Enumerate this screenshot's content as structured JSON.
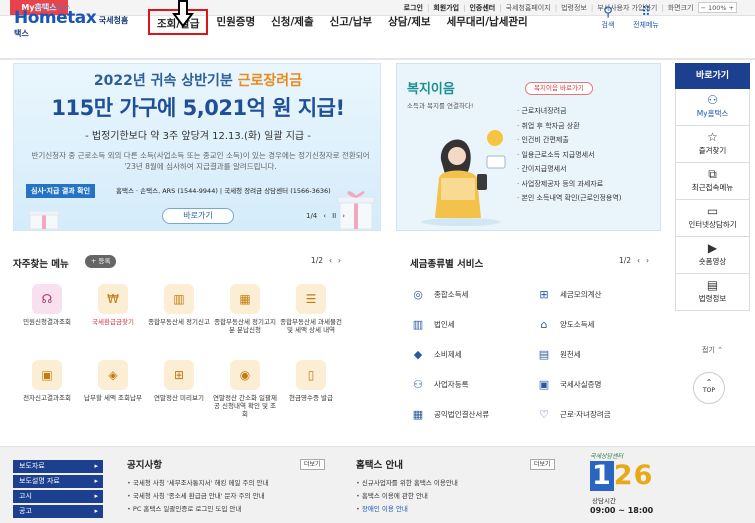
{
  "topbar": {
    "my_tab": "My홈택스",
    "login": "로그인",
    "signup": "회원가입",
    "cert_center": "인증센터",
    "links": [
      "국세청홈페이지",
      "법령정보",
      "부서사용자 가입하기",
      "화면크기"
    ],
    "zoom": "100%",
    "zoom_minus": "−",
    "zoom_plus": "+"
  },
  "header": {
    "logo_main": "Hometax",
    "logo_sub": "국세청홈택스",
    "logo_tag": "편리한 납세서비스",
    "nav": [
      "조회/발급",
      "민원증명",
      "신청/제출",
      "신고/납부",
      "상담/제보",
      "세무대리/납세관리"
    ],
    "search": "검색",
    "all_menu": "전체메뉴"
  },
  "banner": {
    "line1_prefix": "2022년 귀속 상반기분",
    "line1_highlight": "근로장려금",
    "line2": "115만 가구에 5,021억 원 지급!",
    "line3": "- 법정기한보다 약 3주 앞당겨 12.13.(화) 일괄 지급 -",
    "line4": "반기신청자 중 근로소득 외의 다른 소득(사업소득 또는 종교인 소득)이 있는 경우에는 정기신청자로 전환되어 '23년 8월에 심사하여 지급결과를 알려드립니다.",
    "chip": "심사·지급 결과 확인",
    "contact": "홈택스 · 손택스, ARS (1544-9944) | 국세청 장려금 상담센터 (1566-3636)",
    "goto": "바로가기",
    "pager": "1/4",
    "prev": "‹",
    "pause": "II",
    "next": "›"
  },
  "welfare": {
    "title": "복지이음",
    "subtitle": "소득과 복지를 연결하다!",
    "button": "복지이음 바로가기",
    "items": [
      "근로자녀장려금",
      "취업 후 학자금 상환",
      "인건비 간편제출",
      "일용근로소득 지급명세서",
      "간이지급명세서",
      "사업장제공자 등의 과세자료",
      "본인 소득내역 확인(근로인정용역)"
    ]
  },
  "quick": {
    "title": "바로가기",
    "items": [
      {
        "label": "My홈택스",
        "icon": "person-icon"
      },
      {
        "label": "즐겨찾기",
        "icon": "star-icon"
      },
      {
        "label": "최근접속메뉴",
        "icon": "recent-icon"
      },
      {
        "label": "인터넷상담하기",
        "icon": "chat-icon"
      },
      {
        "label": "숏폼영상",
        "icon": "play-icon"
      },
      {
        "label": "법령정보",
        "icon": "book-icon"
      }
    ],
    "fold": "접기 ⌃",
    "top": "TOP"
  },
  "fav": {
    "title": "자주찾는 메뉴",
    "register": "+ 등록",
    "pager": "1/2",
    "prev": "‹",
    "next": "›",
    "items": [
      "민원신청결과조회",
      "국세환급금찾기",
      "종합부동산세 정기신고",
      "종합부동산세 정기고지분 분납신청",
      "종합부동산세 과세물건 및 세액 상세 내역",
      "전자신고결과조회",
      "납부할 세액 조회납부",
      "연말정산 미리보기",
      "연말정산 간소화 일괄제공 신청내역 확인 및 조회",
      "현금영수증 발급"
    ]
  },
  "tax": {
    "title": "세금종류별 서비스",
    "pager": "1/2",
    "prev": "‹",
    "next": "›",
    "items": [
      "종합소득세",
      "세금모의계산",
      "법인세",
      "양도소득세",
      "소비제세",
      "원천세",
      "사업자등록",
      "국세사실증명",
      "공익법인결산서류",
      "근로·자녀장려금"
    ]
  },
  "bottom": {
    "links": [
      "보도자료",
      "보도설명 자료",
      "고시",
      "공고"
    ],
    "notice_title": "공지사항",
    "notice_more": "더보기",
    "notices": [
      "국세청 사칭 '세무조사통지서' 해킹 메일 주의 안내",
      "국세청 사칭 '종소세 환급금 안내' 문자 주의 안내",
      "PC 홈택스 일괄인증로 로그인 도입 안내"
    ],
    "info_title": "홈택스 안내",
    "info_more": "더보기",
    "infos": [
      "신규사업자를 위한 홈택스 이용안내",
      "홈택스 이용에 관한 안내",
      "장애인 이용 안내"
    ],
    "cc_label": "국세상담센터",
    "cc_num_1": "1",
    "cc_num_rest": "26",
    "cc_hours_label": "상담시간",
    "cc_hours": "09:00 ~ 18:00"
  }
}
